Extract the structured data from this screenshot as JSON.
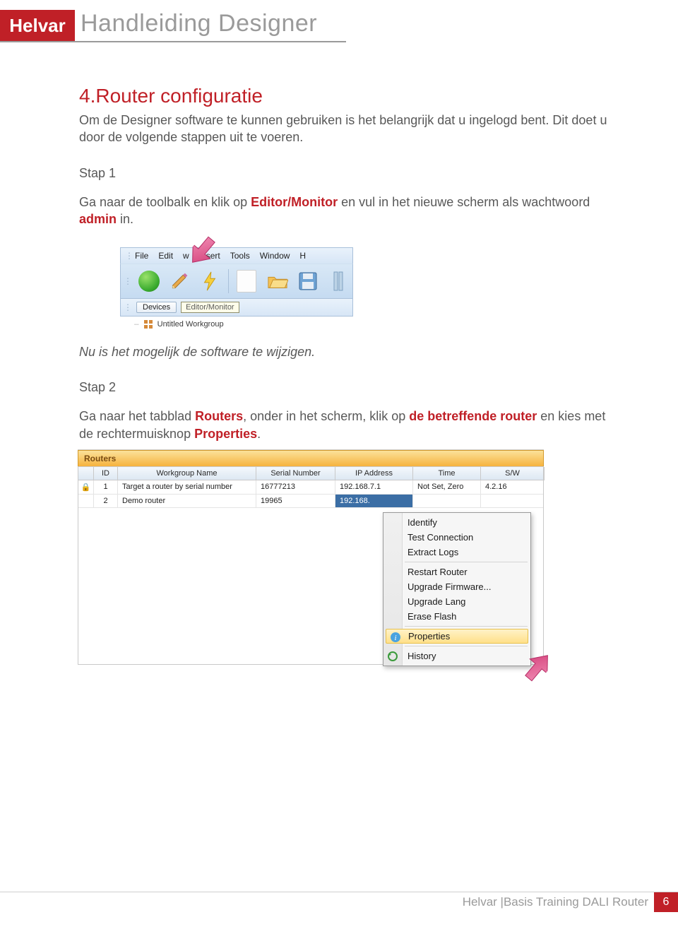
{
  "header": {
    "brand": "Helvar",
    "doc_title": "Handleiding Designer"
  },
  "section": {
    "title": "4.Router configuratie",
    "intro": "Om de Designer software te kunnen gebruiken is het belangrijk dat u ingelogd bent. Dit doet u door de volgende stappen uit te voeren."
  },
  "step1": {
    "label": "Stap 1",
    "text_pre": "Ga naar de toolbalk en klik op ",
    "accent1": "Editor/Monitor",
    "text_mid": " en vul in het nieuwe scherm als wachtwoord ",
    "accent2": "admin",
    "text_post": " in.",
    "afterline": "Nu is het mogelijk de software te wijzigen."
  },
  "shot1": {
    "menus": [
      "File",
      "Edit",
      "w",
      "Insert",
      "Tools",
      "Window",
      "H"
    ],
    "devices_btn": "Devices",
    "tooltip": "Editor/Monitor",
    "tree_label": "Untitled Workgroup"
  },
  "step2": {
    "label": "Stap 2",
    "t1": "Ga naar het tabblad ",
    "a1": "Routers",
    "t2": ", onder in het scherm, klik op ",
    "a2": "de betreffende router",
    "t3": " en kies met de rechtermuisknop ",
    "a3": "Properties",
    "t4": "."
  },
  "shot2": {
    "tab": "Routers",
    "columns": [
      "",
      "ID",
      "Workgroup Name",
      "Serial Number",
      "IP Address",
      "Time",
      "S/W"
    ],
    "rows": [
      {
        "id": "1",
        "name": "Target a router by serial number",
        "serial": "16777213",
        "ip": "192.168.7.1",
        "time": "Not Set, Zero",
        "sw": "4.2.16"
      },
      {
        "id": "2",
        "name": "Demo router",
        "serial": "19965",
        "ip": "192.168.",
        "time": "",
        "sw": ""
      }
    ],
    "context_menu": [
      "Identify",
      "Test Connection",
      "Extract Logs",
      "---",
      "Restart Router",
      "Upgrade Firmware...",
      "Upgrade Lang",
      "Erase Flash",
      "---",
      "Properties",
      "---",
      "History"
    ],
    "highlight": "Properties"
  },
  "footer": {
    "text": "Helvar |Basis Training DALI Router",
    "page": "6"
  }
}
